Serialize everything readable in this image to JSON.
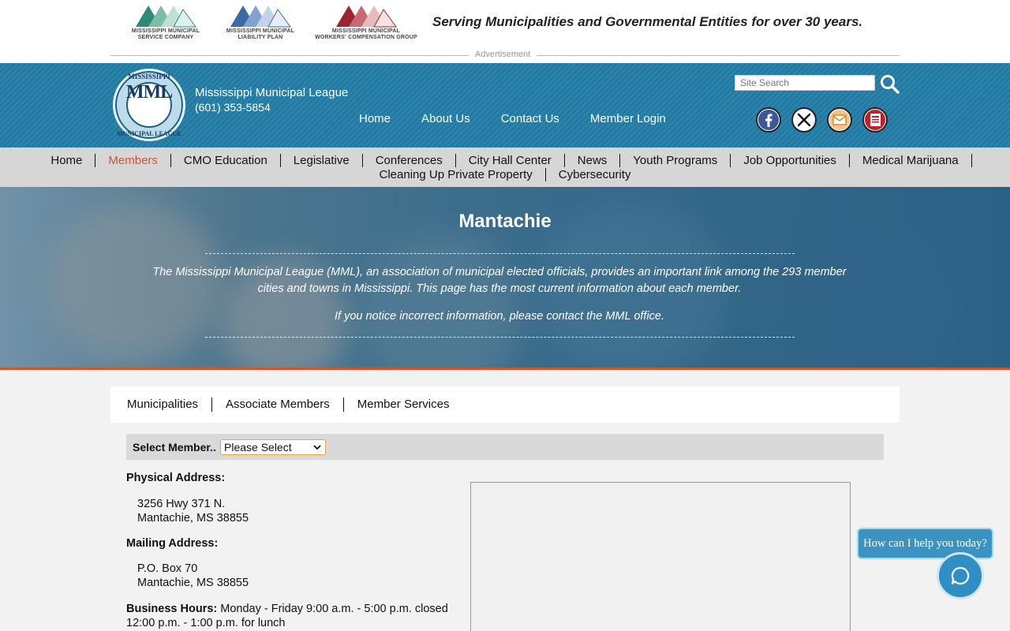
{
  "ad": {
    "logos": [
      {
        "line1": "MISSISSIPPI MUNICIPAL",
        "line2": "SERVICE COMPANY",
        "color": "#2f8a78"
      },
      {
        "line1": "MISSISSIPPI MUNICIPAL",
        "line2": "LIABILITY PLAN",
        "color": "#3a6aa8"
      },
      {
        "line1": "MISSISSIPPI MUNICIPAL",
        "line2": "WORKERS' COMPENSATION GROUP",
        "color": "#9e2432"
      }
    ],
    "tagline": "Serving Municipalities and Governmental Entities for over 30 years.",
    "label": "Advertisement"
  },
  "header": {
    "seal": {
      "top": "MISSISSIPPI",
      "mark": "MML",
      "bottom": "MUNICIPAL LEAGUE"
    },
    "org_name": "Mississippi Municipal League",
    "phone": "(601) 353-5854",
    "top_nav": [
      "Home",
      "About Us",
      "Contact Us",
      "Member Login"
    ],
    "search_placeholder": "Site Search",
    "social": [
      {
        "name": "facebook-icon",
        "color": "#3b5998"
      },
      {
        "name": "x-icon",
        "color": "#111111"
      },
      {
        "name": "email-icon",
        "color": "#d98a2b"
      },
      {
        "name": "newsletter-icon",
        "color": "#c0202a"
      }
    ],
    "bg_color": "#237ea8"
  },
  "main_nav": {
    "row1": [
      "Home",
      "Members",
      "CMO Education",
      "Legislative",
      "Conferences",
      "City Hall Center",
      "News",
      "Youth Programs",
      "Job Opportunities",
      "Medical Marijuana"
    ],
    "row2": [
      "Cleaning Up Private Property",
      "Cybersecurity"
    ],
    "active": "Members",
    "active_color": "#d2542a"
  },
  "hero": {
    "title": "Mantachie",
    "paragraph1": "The Mississippi Municipal League (MML), an association of municipal elected officials, provides an important link among the 293 member cities and towns in Mississippi. This page has the most current information about each member.",
    "paragraph2": "If you notice incorrect information, please contact the MML office."
  },
  "sub_nav": [
    "Municipalities",
    "Associate Members",
    "Member Services"
  ],
  "select_member": {
    "label": "Select Member..",
    "value": "Please Select"
  },
  "member": {
    "physical_label": "Physical Address:",
    "physical_line1": "3256 Hwy 371 N.",
    "physical_line2": "Mantachie, MS 38855",
    "mailing_label": "Mailing Address:",
    "mailing_line1": "P.O. Box 70",
    "mailing_line2": "Mantachie, MS 38855",
    "hours_label": "Business Hours:",
    "hours_value": "Monday - Friday 9:00 a.m. - 5:00 p.m. closed 12:00 p.m. - 1:00 p.m. for lunch"
  },
  "chat": {
    "prompt": "How can I help you today?"
  }
}
